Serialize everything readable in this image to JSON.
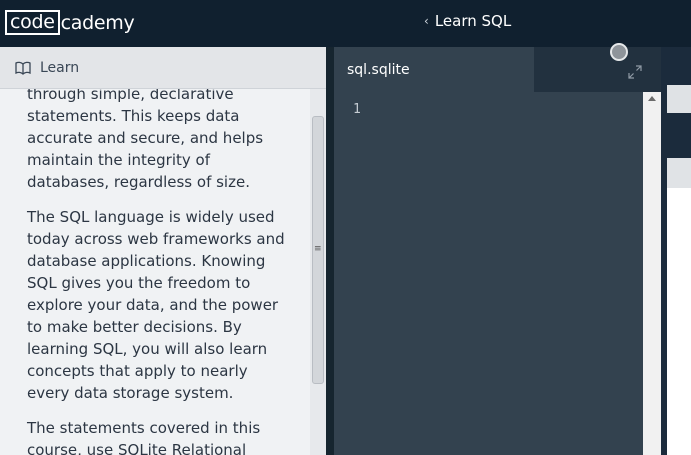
{
  "topbar": {
    "logo_boxed": "code",
    "logo_rest": "cademy",
    "course_title": "Learn SQL"
  },
  "learn_panel": {
    "header_label": "Learn",
    "paragraphs": [
      "through simple, declarative statements. This keeps data accurate and secure, and helps maintain the integrity of databases, regardless of size.",
      "The SQL language is widely used today across web frameworks and database applications. Knowing SQL gives you the freedom to explore your data, and the power to make better decisions. By learning SQL, you will also learn concepts that apply to nearly every data storage system.",
      "The statements covered in this course, use SQLite Relational"
    ]
  },
  "editor": {
    "tab_label": "sql.sqlite",
    "line_number": "1"
  },
  "icons": {
    "learn": "book-icon",
    "expand": "expand-icon",
    "back": "chevron-left-icon"
  },
  "colors": {
    "topbar": "#10202f",
    "editor_bg": "#33424f",
    "learn_bg": "#f0f2f4"
  }
}
